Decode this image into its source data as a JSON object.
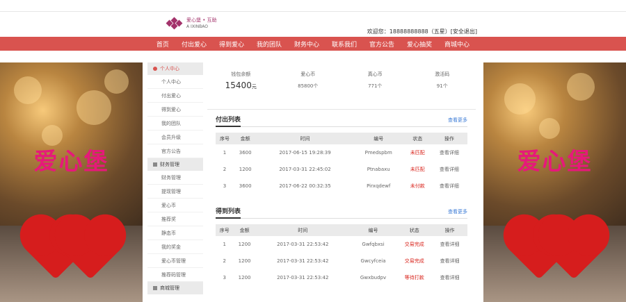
{
  "header": {
    "logo_cn": "爱心堡 • 互助",
    "logo_en": "A IXINBAO",
    "welcome": "欢迎您：18888888888（五星）[安全退出]"
  },
  "nav": [
    "首页",
    "付出爱心",
    "得到爱心",
    "我的团队",
    "财务中心",
    "联系我们",
    "官方公告",
    "爱心抽奖",
    "商城中心"
  ],
  "banner_title": "爱心堡",
  "sidebar": [
    {
      "group": "个人中心",
      "active": true,
      "items": [
        "个人中心",
        "付出爱心",
        "得到爱心",
        "我的团队",
        "会员升级",
        "官方公告"
      ]
    },
    {
      "group": "财务管理",
      "active": false,
      "items": [
        "财务管理",
        "提现管理",
        "爱心币",
        "推荐奖",
        "静态币",
        "我的奖金",
        "爱心币管理",
        "推荐码管理"
      ]
    },
    {
      "group": "商城管理",
      "active": false,
      "items": []
    }
  ],
  "stats": [
    {
      "label": "钱包余额",
      "value": "15400",
      "unit": "元"
    },
    {
      "label": "爱心币",
      "value": "85800个"
    },
    {
      "label": "真心币",
      "value": "771个"
    },
    {
      "label": "激活码",
      "value": "91个"
    }
  ],
  "pay_list": {
    "title": "付出列表",
    "more": "查看更多",
    "headers": [
      "序号",
      "金额",
      "时间",
      "编号",
      "状态",
      "操作"
    ],
    "rows": [
      [
        "1",
        "3600",
        "2017-06-15 19:28:39",
        "Pmedspbm",
        "未匹配",
        "查看详细"
      ],
      [
        "2",
        "1200",
        "2017-03-31 22:45:02",
        "Ptnabaxu",
        "未匹配",
        "查看详细"
      ],
      [
        "3",
        "3600",
        "2017-06-22 00:32:35",
        "Pirxqdewf",
        "未付款",
        "查看详细"
      ]
    ]
  },
  "get_list": {
    "title": "得到列表",
    "more": "查看更多",
    "headers": [
      "序号",
      "金额",
      "时间",
      "编号",
      "状态",
      "操作"
    ],
    "rows": [
      [
        "1",
        "1200",
        "2017-03-31 22:53:42",
        "Gwfqbxsi",
        "交易完成",
        "查看详细"
      ],
      [
        "2",
        "1200",
        "2017-03-31 22:53:42",
        "Gwcyfceia",
        "交易完成",
        "查看详细"
      ],
      [
        "3",
        "1200",
        "2017-03-31 22:53:42",
        "Gwxbudpv",
        "等待打款",
        "查看详细"
      ]
    ]
  },
  "colors": {
    "nav_bg": "#d9534f",
    "status_red": "#d9251d",
    "brand": "#a3336b"
  }
}
